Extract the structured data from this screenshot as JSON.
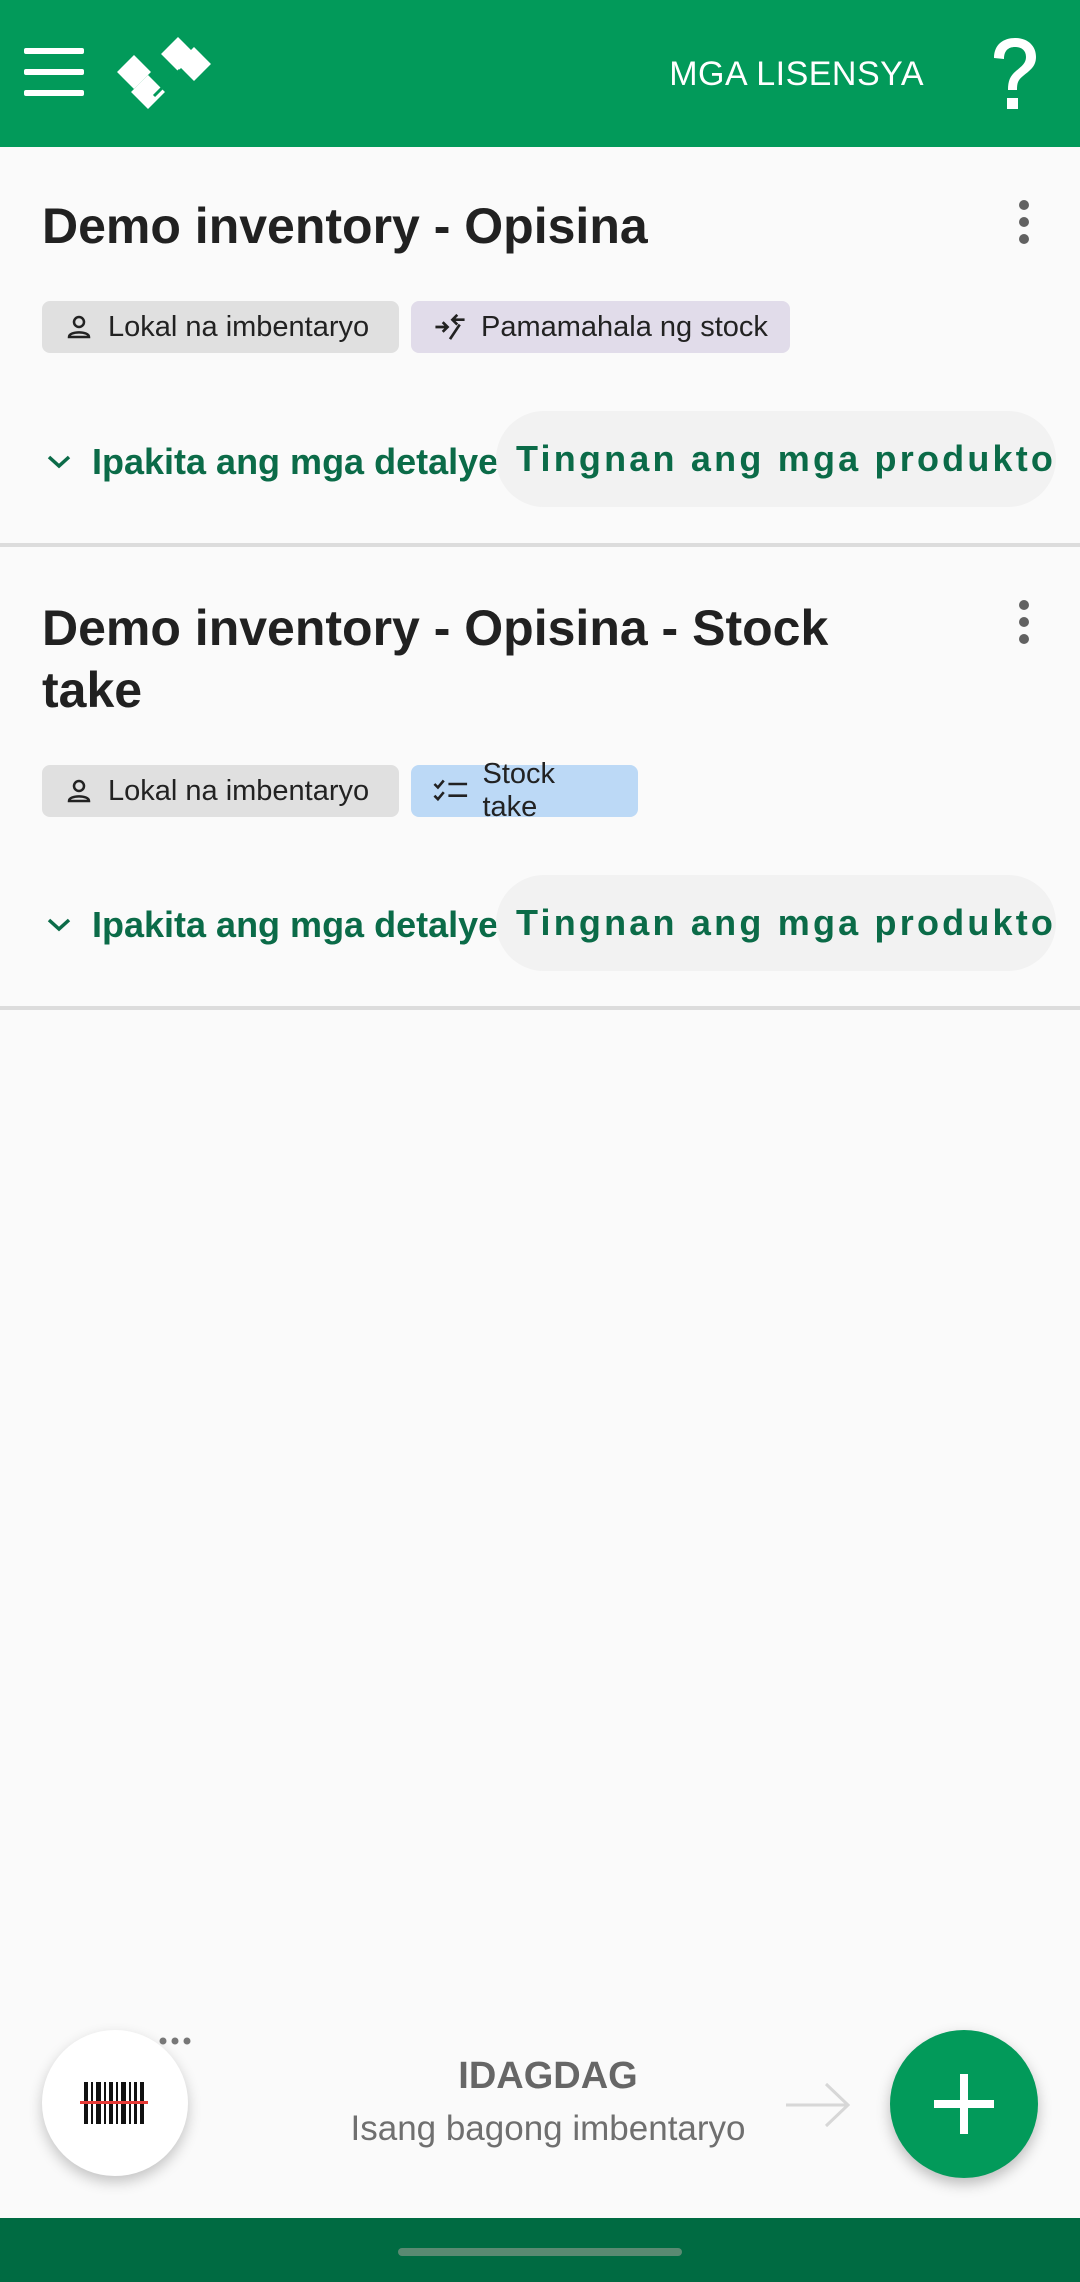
{
  "appbar": {
    "licenses_label": "MGA LISENSYA",
    "menu_icon": "hamburger-menu-icon",
    "logo_icon": "app-logo-icon",
    "help_icon": "question-mark-icon",
    "background_color": "#029a5a"
  },
  "inventories": [
    {
      "title": "Demo inventory - Opisina",
      "chips": [
        {
          "label": "Lokal na imbentaryo",
          "icon": "person-icon"
        },
        {
          "label": "Pamamahala ng stock",
          "icon": "stock-management-icon"
        }
      ],
      "details_label": "Ipakita ang mga detalye",
      "view_products_label": "Tingnan ang mga produkto"
    },
    {
      "title": "Demo inventory - Opisina - Stock take",
      "chips": [
        {
          "label": "Lokal na imbentaryo",
          "icon": "person-icon"
        },
        {
          "label": "Stock take",
          "icon": "checklist-icon"
        }
      ],
      "details_label": "Ipakita ang mga detalye",
      "view_products_label": "Tingnan ang mga produkto"
    }
  ],
  "bottom": {
    "add_title": "IDAGDAG",
    "add_subtitle": "Isang bagong imbentaryo",
    "scan_icon": "barcode-scan-icon",
    "add_icon": "plus-icon",
    "accent_color": "#029a5a",
    "nav_bar_color": "#006b42"
  }
}
